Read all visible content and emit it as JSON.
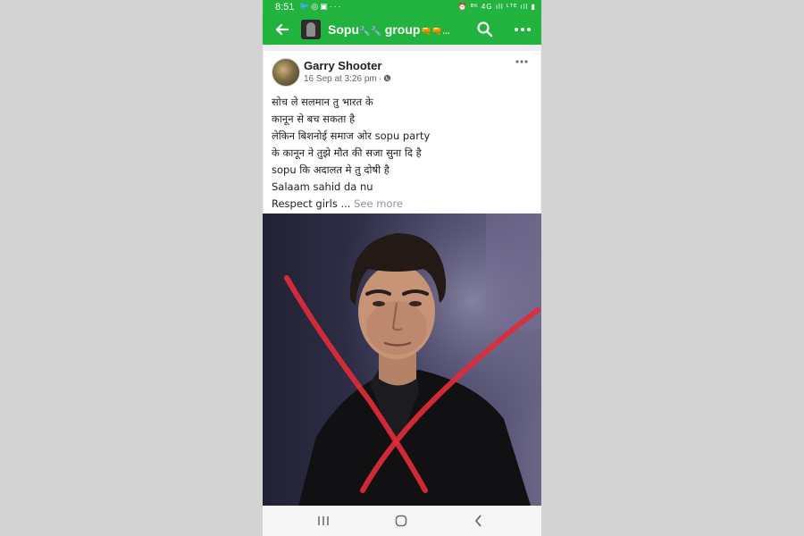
{
  "status_bar": {
    "time": "8:51",
    "left_icons": [
      "twitter-icon",
      "whatsapp-icon",
      "image-icon",
      "more-dots-icon"
    ],
    "right_text": "⏰ ᴮᴷ 4G ıll ᴸᵀᴱ ıll ▮"
  },
  "app_bar": {
    "group_title": "Sopu",
    "group_title_decor_1": "🔧🔧",
    "group_title_suffix": "group",
    "group_title_decor_2": "🔫🔫...",
    "icons": [
      "back-arrow-icon",
      "search-icon",
      "more-dots-icon"
    ]
  },
  "post": {
    "author": "Garry Shooter",
    "date": "16 Sep at 3:26 pm",
    "privacy_icon": "globe-icon",
    "lines": [
      "सोच ले सलमान तु भारत के",
      "कानून से बच सकता है",
      "लेकिन बिशनोई समाज ओर sopu party",
      "के कानून ने तुझे मौत की सजा सुना दि है",
      "sopu कि अदालत मे तु दोषी है",
      "Salaam sahid da nu"
    ],
    "last_line": "Respect girls ...",
    "see_more": "See more"
  },
  "image": {
    "description": "photo-of-man-with-red-x",
    "x_color": "#e02b3a"
  },
  "nav_bar": {
    "icons": [
      "recent-apps-icon",
      "home-icon",
      "back-icon"
    ]
  },
  "colors": {
    "brand_green": "#22b33e",
    "background": "#d3d3d3"
  }
}
